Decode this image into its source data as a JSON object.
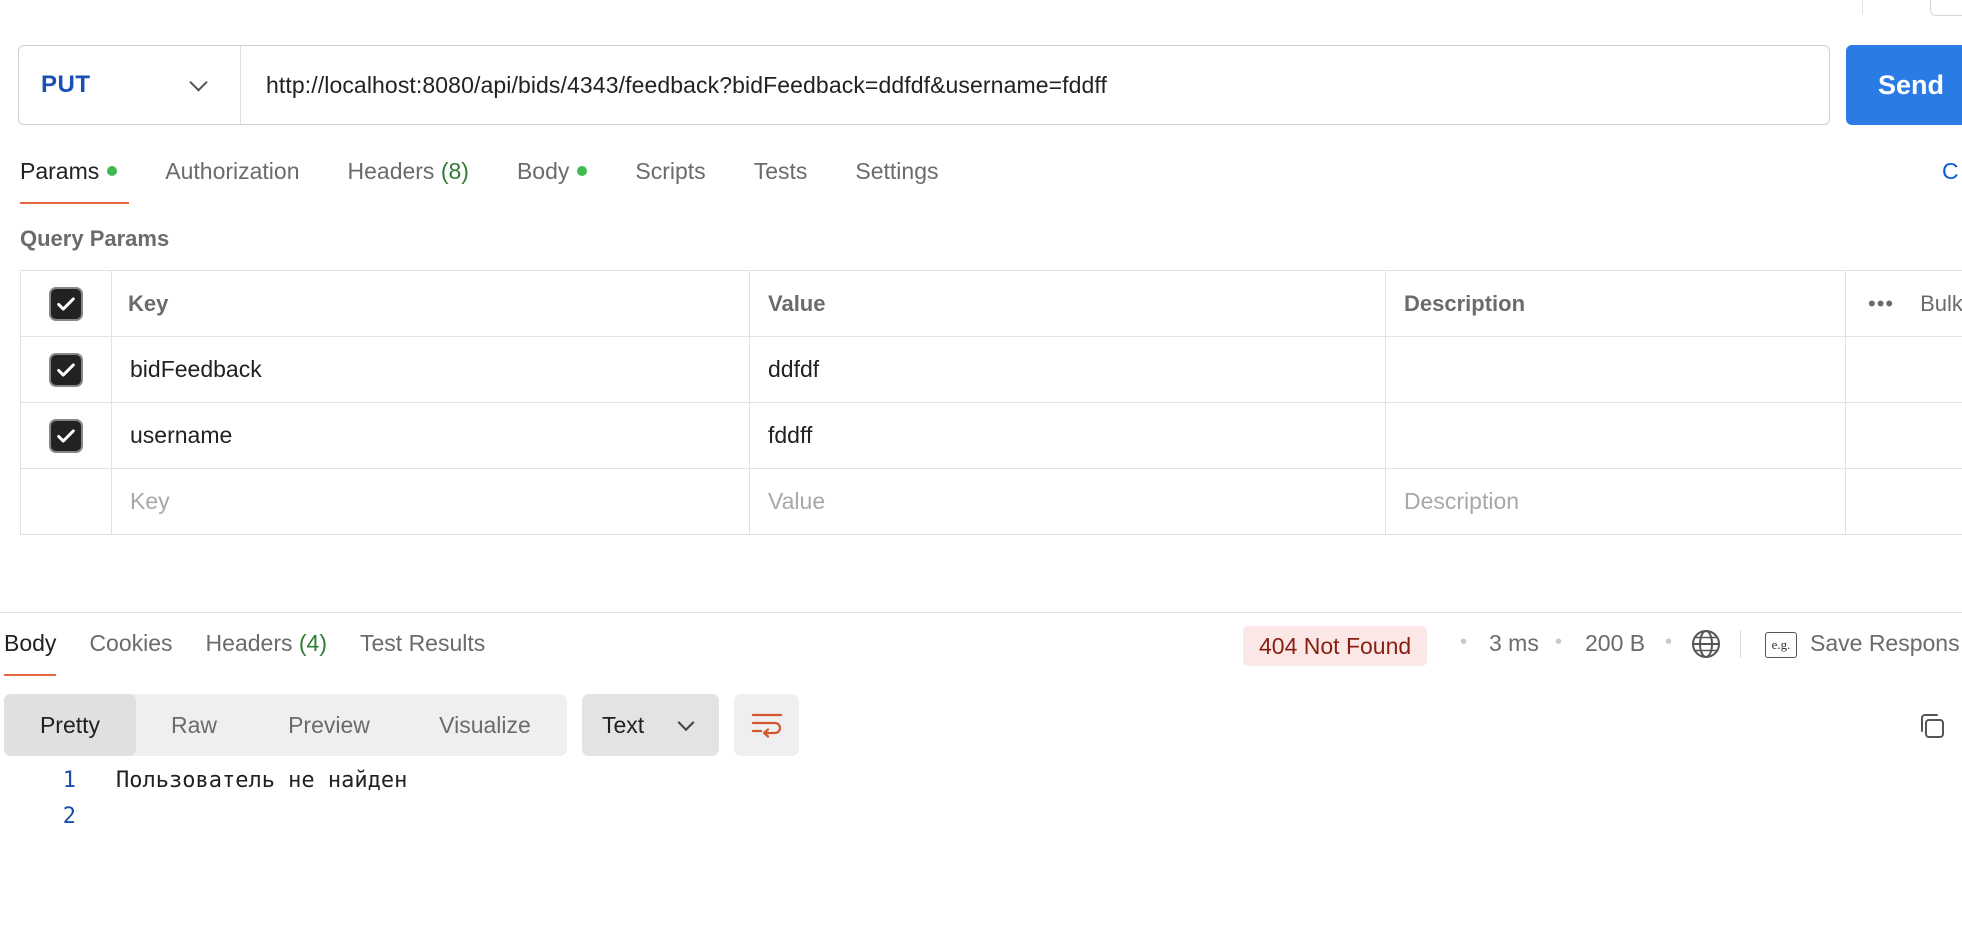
{
  "request": {
    "method": "PUT",
    "url": "http://localhost:8080/api/bids/4343/feedback?bidFeedback=ddfdf&username=fddff",
    "send_label": "Send"
  },
  "request_tabs": {
    "params": "Params",
    "authorization": "Authorization",
    "headers": "Headers",
    "headers_count": "(8)",
    "body": "Body",
    "scripts": "Scripts",
    "tests": "Tests",
    "settings": "Settings",
    "cookies_partial": "C"
  },
  "query_params": {
    "title": "Query Params",
    "headers": {
      "key": "Key",
      "value": "Value",
      "description": "Description",
      "more": "•••",
      "bulk": "Bulk"
    },
    "rows": [
      {
        "checked": true,
        "key": "bidFeedback",
        "value": "ddfdf",
        "description": ""
      },
      {
        "checked": true,
        "key": "username",
        "value": "fddff",
        "description": ""
      }
    ],
    "placeholders": {
      "key": "Key",
      "value": "Value",
      "description": "Description"
    }
  },
  "response": {
    "tabs": {
      "body": "Body",
      "cookies": "Cookies",
      "headers": "Headers",
      "headers_count": "(4)",
      "test_results": "Test Results"
    },
    "status": "404 Not Found",
    "time": "3 ms",
    "size": "200 B",
    "save_label": "Save Respons",
    "sep": "•",
    "eg_label": "e.g.",
    "views": {
      "pretty": "Pretty",
      "raw": "Raw",
      "preview": "Preview",
      "visualize": "Visualize"
    },
    "format": "Text",
    "lines": [
      {
        "num": "1",
        "text": "Пользователь не найден"
      },
      {
        "num": "2",
        "text": ""
      }
    ]
  },
  "colors": {
    "accent_tab": "#e8663d",
    "send_button": "#2a7be4",
    "status_bg": "#fbe8e6",
    "status_text": "#8b1e13",
    "dot_green": "#3fb950"
  }
}
